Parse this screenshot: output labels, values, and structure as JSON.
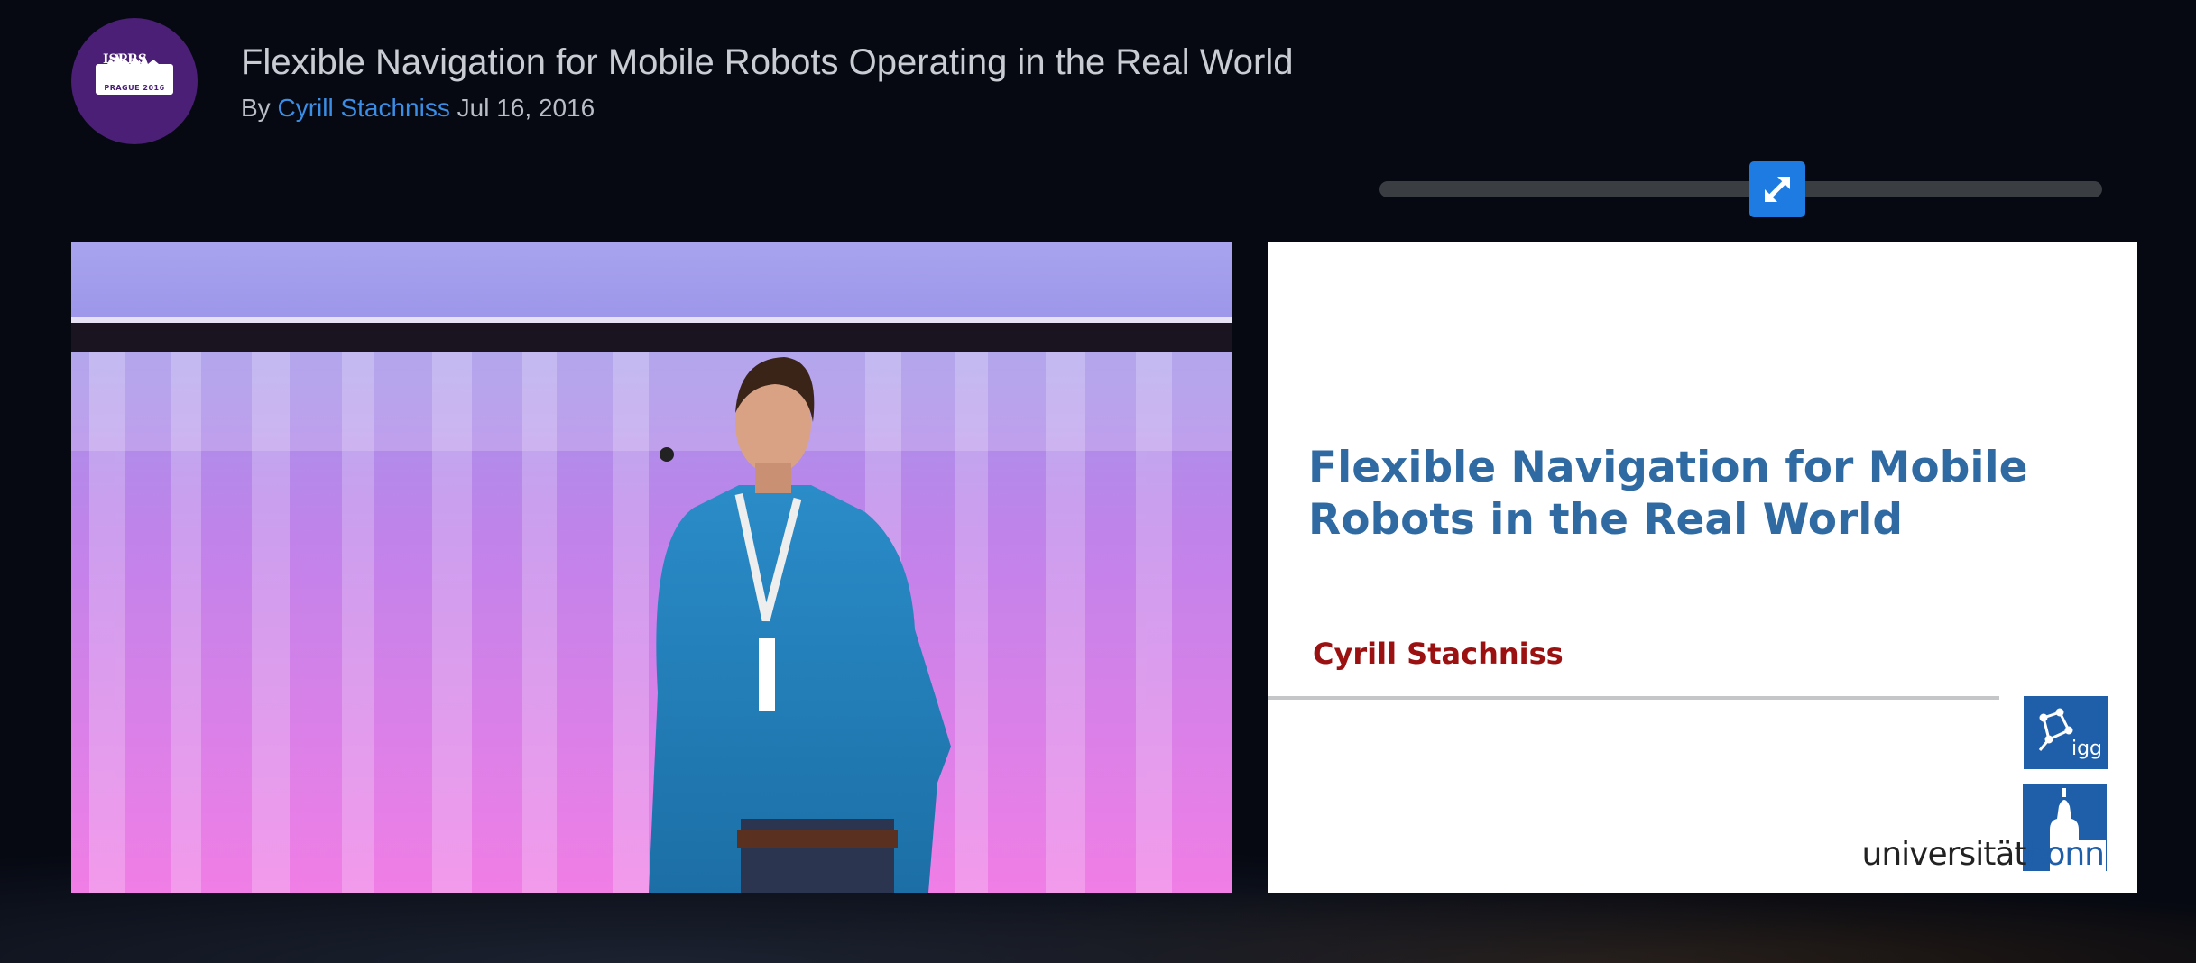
{
  "channel": {
    "logo_text": "ISPRS",
    "logo_badge": "PRAGUE 2016"
  },
  "video_info": {
    "title": "Flexible Navigation for Mobile Robots Operating in the Real World",
    "by_label": "By",
    "author": "Cyrill Stachniss",
    "date": "Jul 16, 2016"
  },
  "split_slider": {
    "position": 0.55,
    "icon": "resize-diagonal-icon"
  },
  "slide": {
    "title_line1": "Flexible Navigation for Mobile",
    "title_line2": "Robots in the Real World",
    "author": "Cyrill Stachniss",
    "igg_logo_text": "igg",
    "university_prefix": "universität",
    "university_suffix": "bonn"
  },
  "colors": {
    "background": "#060912",
    "accent": "#1e7be2",
    "author_link": "#3a8ee6",
    "slide_title": "#2f6aa3",
    "slide_author": "#9b1010",
    "avatar": "#4a1f75"
  }
}
